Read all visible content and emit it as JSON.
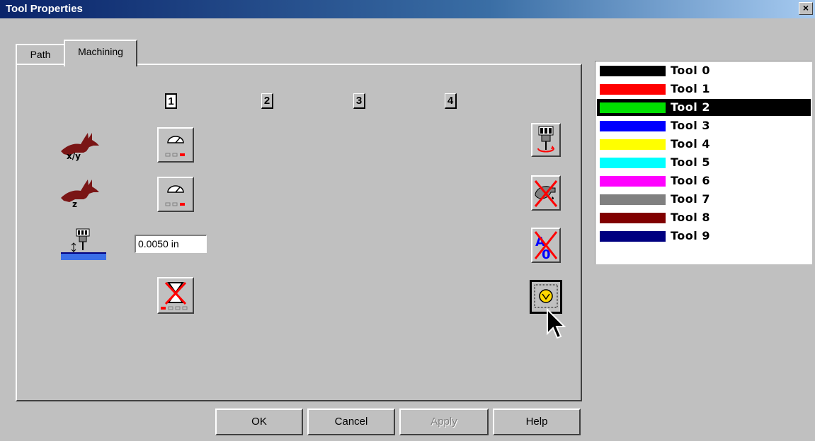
{
  "window": {
    "title": "Tool Properties",
    "close_label": "×"
  },
  "tabs": [
    {
      "label": "Path"
    },
    {
      "label": "Machining"
    }
  ],
  "columns": [
    "1",
    "2",
    "3",
    "4"
  ],
  "depth_field": {
    "value": "0.0050 in"
  },
  "row_labels": {
    "xy": "x/y",
    "z": "z"
  },
  "side_buttons": {
    "aux_top": "A",
    "aux_bottom": "0"
  },
  "buttons": {
    "ok": "OK",
    "cancel": "Cancel",
    "apply": "Apply",
    "help": "Help"
  },
  "tools": [
    {
      "label": "Tool 0",
      "color": "#000000"
    },
    {
      "label": "Tool 1",
      "color": "#ff0000"
    },
    {
      "label": "Tool 2",
      "color": "#00e000"
    },
    {
      "label": "Tool 3",
      "color": "#0000ff"
    },
    {
      "label": "Tool 4",
      "color": "#ffff00"
    },
    {
      "label": "Tool 5",
      "color": "#00ffff"
    },
    {
      "label": "Tool 6",
      "color": "#ff00ff"
    },
    {
      "label": "Tool 7",
      "color": "#808080"
    },
    {
      "label": "Tool 8",
      "color": "#800000"
    },
    {
      "label": "Tool 9",
      "color": "#000080"
    }
  ],
  "selected_tool": "Tool 2"
}
